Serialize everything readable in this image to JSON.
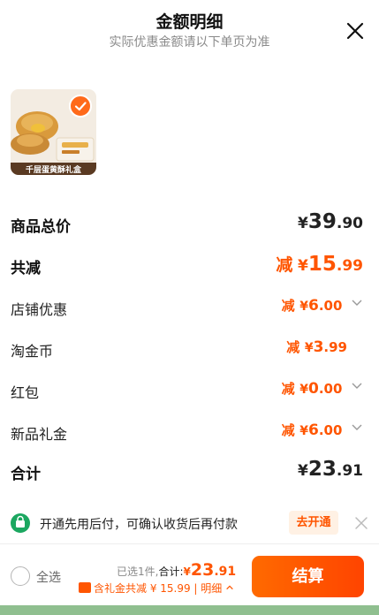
{
  "header": {
    "title": "金额明细",
    "subtitle": "实际优惠金额请以下单页为准"
  },
  "product": {
    "image_caption": "千层蛋黄酥礼盒"
  },
  "summary": {
    "total": {
      "label": "商品总价",
      "yen": "¥",
      "int": "39",
      "dec": ".90"
    },
    "discount": {
      "label": "共减",
      "prefix": "减",
      "yen": "¥",
      "int": "15",
      "dec": ".99"
    },
    "items": [
      {
        "label": "店铺优惠",
        "prefix": "减",
        "yen": "¥",
        "int": "6",
        "dec": ".00",
        "has_chevron": true
      },
      {
        "label": "淘金币",
        "prefix": "减",
        "yen": "¥",
        "int": "3",
        "dec": ".99",
        "has_chevron": false
      },
      {
        "label": "红包",
        "prefix": "减",
        "yen": "¥",
        "int": "0",
        "dec": ".00",
        "has_chevron": true
      },
      {
        "label": "新品礼金",
        "prefix": "减",
        "yen": "¥",
        "int": "6",
        "dec": ".00",
        "has_chevron": true
      }
    ],
    "subtotal": {
      "label": "合计",
      "yen": "¥",
      "int": "23",
      "dec": ".91"
    }
  },
  "notice": {
    "text": "开通先用后付，可确认收货后再付款",
    "button": "去开通"
  },
  "bottom_bar": {
    "select_all": "全选",
    "selected_count": "已选1件,",
    "sum_label": "合计:",
    "sum_yen": "¥",
    "sum_int": "23",
    "sum_dec": ".91",
    "gift_line": "含礼金共减 ¥ 15.99 | 明细",
    "checkout": "结算"
  },
  "colors": {
    "accent": "#ff5500",
    "check_badge": "#ff6a1a",
    "notice_icon": "#1ba760",
    "notice_button_bg": "#fff1e4"
  },
  "icons": [
    "close-icon",
    "check-icon",
    "chevron-down-icon",
    "chevron-up-icon",
    "pay-later-icon",
    "gift-icon"
  ]
}
